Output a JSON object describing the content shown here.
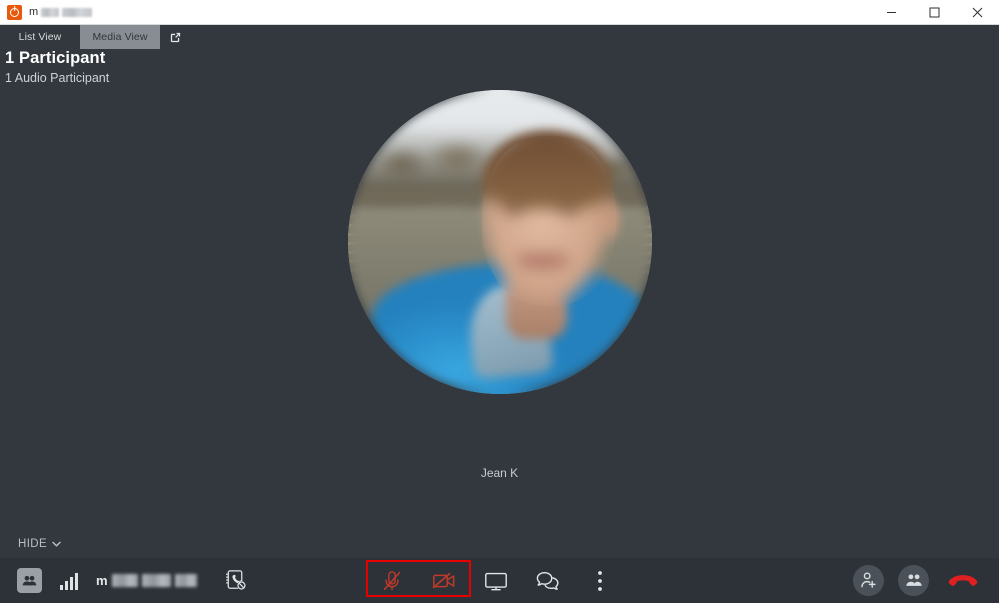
{
  "window": {
    "title_prefix": "m",
    "title_redacted": true,
    "icon": "app-icon",
    "controls": {
      "minimize": "minimize-icon",
      "maximize": "maximize-icon",
      "close": "close-icon"
    }
  },
  "tabs": {
    "items": [
      {
        "label": "List View",
        "active": false
      },
      {
        "label": "Media View",
        "active": true
      }
    ],
    "popout_icon": "pop-out-icon"
  },
  "header": {
    "title": "1 Participant",
    "subtitle": "1 Audio Participant"
  },
  "stage": {
    "participant_name": "Jean K",
    "avatar": "participant-photo"
  },
  "hide_control": {
    "label": "HIDE",
    "chevron": "chevron-down-icon"
  },
  "bottom_bar": {
    "left": {
      "group_icon": "group-participants-icon",
      "signal_icon": "signal-strength-icon",
      "meeting_label_prefix": "m",
      "meeting_label_redacted": true,
      "dialpad_icon": "contact-card-no-call-icon"
    },
    "center": [
      {
        "name": "microphone-muted",
        "icon": "microphone-off-icon",
        "state": "off"
      },
      {
        "name": "camera-off",
        "icon": "camera-off-icon",
        "state": "off"
      },
      {
        "name": "share-screen",
        "icon": "monitor-icon",
        "state": "on"
      },
      {
        "name": "chat",
        "icon": "chat-bubbles-icon",
        "state": "on"
      },
      {
        "name": "more-options",
        "icon": "more-vertical-icon",
        "state": "on"
      }
    ],
    "right": [
      {
        "name": "add-participant",
        "icon": "person-add-icon"
      },
      {
        "name": "participants",
        "icon": "people-icon"
      },
      {
        "name": "end-call",
        "icon": "hang-up-icon"
      }
    ]
  },
  "annotation": {
    "type": "highlight-rectangle",
    "color": "#e60000",
    "targets": "microphone-and-camera-buttons"
  },
  "colors": {
    "app_background": "#32383e",
    "bottom_bar": "#2c3238",
    "active_tab": "#878d93",
    "accent_red": "#e60000",
    "muted_red": "#c0392b",
    "title_bar": "#ffffff",
    "app_icon_orange": "#e8590c"
  }
}
